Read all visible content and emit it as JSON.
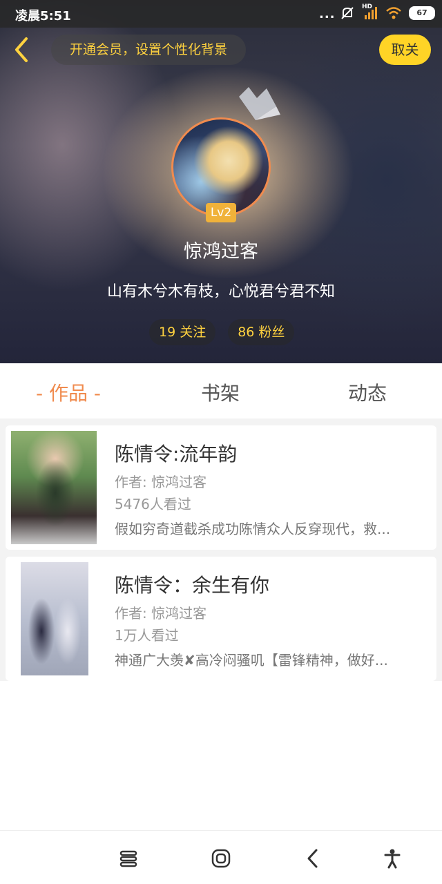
{
  "status_bar": {
    "time": "凌晨5:51",
    "dots": "...",
    "network_label": "HD",
    "battery": "67"
  },
  "header": {
    "back_icon": "chevron-left-icon",
    "vip_prompt": "开通会员，设置个性化背景",
    "unfollow_label": "取关"
  },
  "profile": {
    "level": "Lv2",
    "nickname": "惊鸿过客",
    "signature": "山有木兮木有枝，心悦君兮君不知",
    "following": "19 关注",
    "followers": "86 粉丝"
  },
  "tabs": [
    {
      "label": "- 作品 -",
      "active": true
    },
    {
      "label": "书架",
      "active": false
    },
    {
      "label": "动态",
      "active": false
    }
  ],
  "works": [
    {
      "title": "陈情令:流年韵",
      "author": "作者: 惊鸿过客",
      "views": "5476人看过",
      "description": "假如穷奇道截杀成功陈情众人反穿现代，救..."
    },
    {
      "title": "陈情令：余生有你",
      "author": "作者: 惊鸿过客",
      "views": "1万人看过",
      "description": "神通广大羡✘高冷闷骚叽【雷锋精神，做好..."
    }
  ],
  "nav_bar": {
    "icons": [
      "menu-icon",
      "home-icon",
      "back-icon",
      "accessibility-icon"
    ]
  },
  "colors": {
    "accent": "#f08b4e",
    "vip_text": "#ffd23f",
    "unfollow_bg": "#ffd426"
  }
}
